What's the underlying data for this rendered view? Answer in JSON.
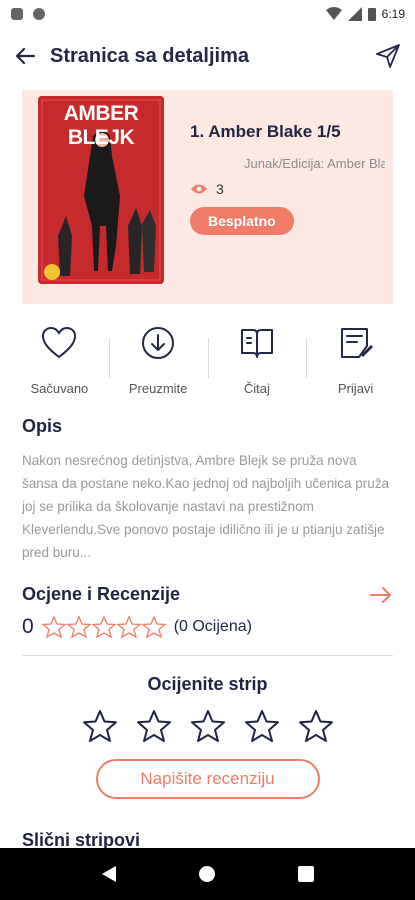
{
  "status_bar": {
    "time": "6:19"
  },
  "app_bar": {
    "title": "Stranica sa detaljima"
  },
  "comic": {
    "cover_title": "AMBER BLEJK",
    "title": "1. Amber Blake 1/5",
    "edition": "Junak/Edicija: Amber Blake",
    "views": "3",
    "price_badge": "Besplatno"
  },
  "actions": [
    {
      "label": "Sačuvano",
      "icon": "heart-icon"
    },
    {
      "label": "Preuzmite",
      "icon": "download-icon"
    },
    {
      "label": "Čitaj",
      "icon": "book-icon"
    },
    {
      "label": "Prijavi",
      "icon": "report-icon"
    }
  ],
  "description": {
    "title": "Opis",
    "text": "Nakon nesrećnog detinjstva, Ambre Blejk se pruža nova šansa da postane neko.Kao jednoj od najboljih učenica pruža joj se prilika da školovanje nastavi na prestižnom Kleverlendu.Sve ponovo postaje idilično ili je u ptianju zatišje pred buru..."
  },
  "ratings": {
    "title": "Ocjene i Recenzije",
    "score": "0",
    "count": "(0 Ocijena)"
  },
  "rate": {
    "title": "Ocijenite strip",
    "button": "Napišite recenziju"
  },
  "similar": {
    "title": "Slični stripovi"
  },
  "colors": {
    "accent": "#f07b68",
    "hero_bg": "#fde9e4",
    "text_dark": "#1f2440"
  }
}
